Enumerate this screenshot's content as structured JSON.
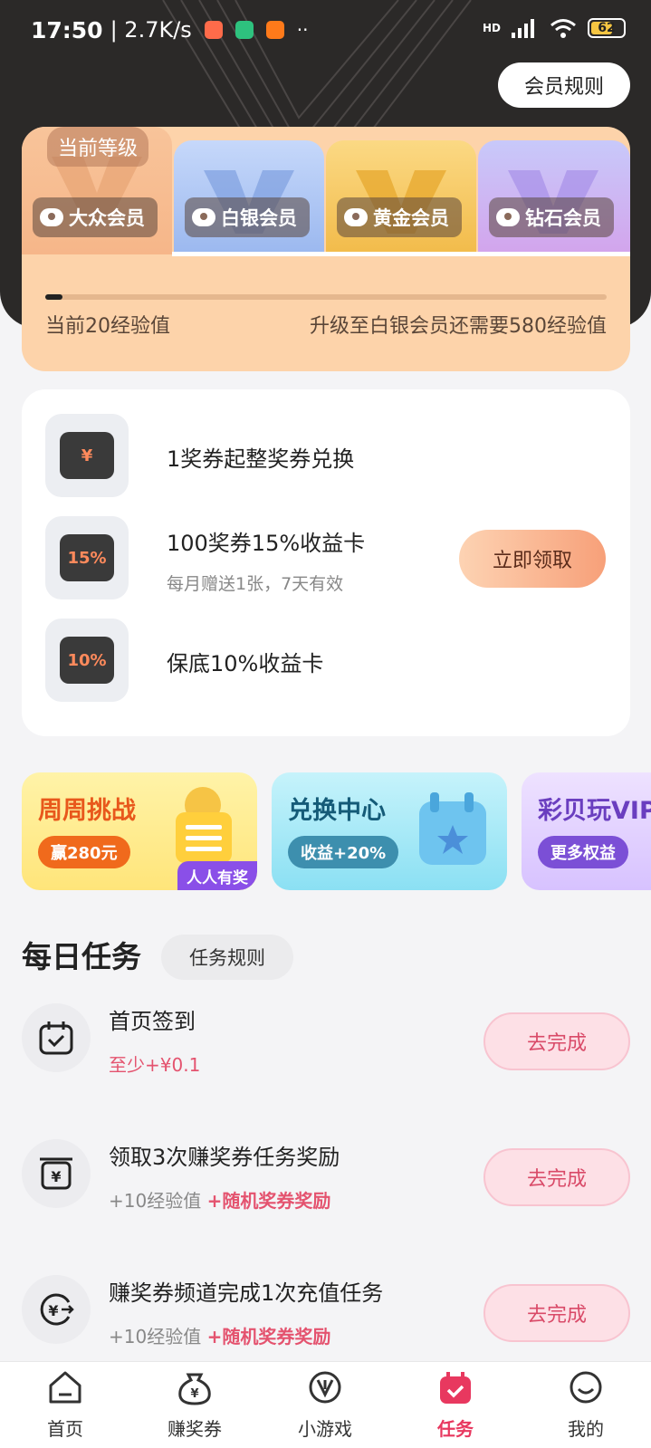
{
  "status_bar": {
    "time": "17:50",
    "speed": "| 2.7K/s",
    "network": "HD",
    "battery": "62"
  },
  "header": {
    "rules_label": "会员规则"
  },
  "levels": {
    "current_label": "当前等级",
    "tiers": [
      "大众会员",
      "白银会员",
      "黄金会员",
      "钻石会员"
    ],
    "progress": 0.03,
    "current_exp": "当前20经验值",
    "upgrade_hint": "升级至白银会员还需要580经验值"
  },
  "benefits": {
    "items": [
      {
        "title": "1奖券起整奖券兑换",
        "icon": "yuan-card-icon",
        "icon_text": "¥"
      },
      {
        "title": "100奖券15%收益卡",
        "subtitle": "每月赠送1张，7天有效",
        "icon": "yield-15-icon",
        "icon_text": "15%"
      },
      {
        "title": "保底10%收益卡",
        "icon": "yield-10-icon",
        "icon_text": "10%"
      }
    ],
    "claim_label": "立即领取"
  },
  "promos": [
    {
      "title": "周周挑战",
      "pill": "赢280元",
      "badge": "人人有奖"
    },
    {
      "title": "兑换中心",
      "pill": "收益+20%"
    },
    {
      "title": "彩贝玩VIP",
      "pill": "更多权益"
    }
  ],
  "daily": {
    "title": "每日任务",
    "rules_label": "任务规则",
    "tasks": [
      {
        "title": "首页签到",
        "reward": "至少+¥0.1",
        "button": "去完成",
        "icon": "calendar-check-icon"
      },
      {
        "title": "领取3次赚奖券任务奖励",
        "exp": "+10经验值",
        "bonus": "+随机奖券奖励",
        "button": "去完成",
        "icon": "yuan-receipt-icon"
      },
      {
        "title": "赚奖券频道完成1次充值任务",
        "exp": "+10经验值",
        "bonus": "+随机奖券奖励",
        "button": "去完成",
        "icon": "yuan-exchange-icon"
      }
    ]
  },
  "nav": {
    "items": [
      {
        "label": "首页",
        "icon": "home-icon"
      },
      {
        "label": "赚奖券",
        "icon": "coin-bag-icon"
      },
      {
        "label": "小游戏",
        "icon": "game-icon"
      },
      {
        "label": "任务",
        "icon": "task-icon"
      },
      {
        "label": "我的",
        "icon": "profile-icon"
      }
    ],
    "active": "任务"
  },
  "colors": {
    "accent": "#e8385f",
    "panel": "#fdd3aa",
    "header_bg": "#2b2928"
  }
}
